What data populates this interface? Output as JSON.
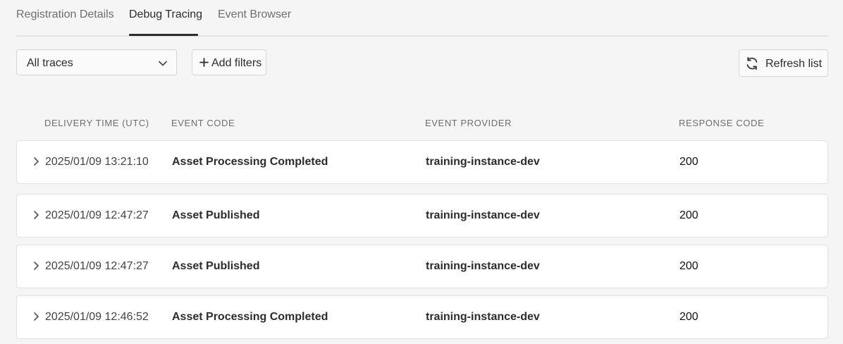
{
  "tabs": [
    {
      "label": "Registration Details"
    },
    {
      "label": "Debug Tracing"
    },
    {
      "label": "Event Browser"
    }
  ],
  "active_tab": "Debug Tracing",
  "toolbar": {
    "trace_filter_value": "All traces",
    "add_filters_label": "Add filters",
    "refresh_label": "Refresh list",
    "icons": [
      "chevron-down-icon",
      "plus-icon",
      "refresh-icon"
    ]
  },
  "table": {
    "headers": {
      "delivery_time": "DELIVERY TIME (UTC)",
      "event_code": "EVENT CODE",
      "event_provider": "EVENT PROVIDER",
      "response_code": "RESPONSE CODE"
    },
    "rows": [
      {
        "delivery_time": "2025/01/09 13:21:10",
        "event_code": "Asset Processing Completed",
        "event_provider": "training-instance-dev",
        "response_code": "200"
      },
      {
        "delivery_time": "2025/01/09 12:47:27",
        "event_code": "Asset Published",
        "event_provider": "training-instance-dev",
        "response_code": "200"
      },
      {
        "delivery_time": "2025/01/09 12:47:27",
        "event_code": "Asset Published",
        "event_provider": "training-instance-dev",
        "response_code": "200"
      },
      {
        "delivery_time": "2025/01/09 12:46:52",
        "event_code": "Asset Processing Completed",
        "event_provider": "training-instance-dev",
        "response_code": "200"
      }
    ]
  },
  "colors": {
    "background": "#f5f5f5",
    "row_background": "#ffffff",
    "active_tab_indicator": "#2c2c2c"
  }
}
